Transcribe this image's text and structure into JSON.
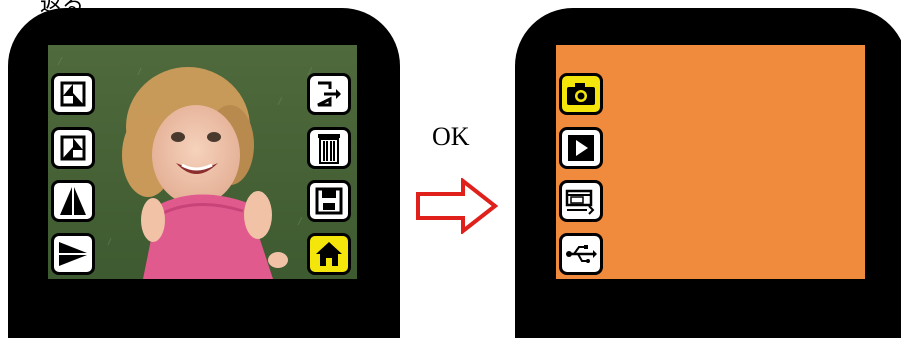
{
  "caption": "返る",
  "transition_label": "OK",
  "colors": {
    "highlight": "#F4E60A",
    "screen_blank": "#F08A3C",
    "arrow": "#E0201B",
    "bezel": "#000000"
  },
  "left_screen": {
    "left_icons": [
      "rotate-left-icon",
      "rotate-right-icon",
      "flip-horizontal-icon",
      "flip-vertical-icon"
    ],
    "right_icons": [
      "exit-icon",
      "trash-icon",
      "save-icon",
      "home-icon"
    ],
    "selected": "home-icon"
  },
  "right_screen": {
    "menu_icons": [
      "camera-icon",
      "play-icon",
      "film-scanner-icon",
      "usb-icon"
    ],
    "selected": "camera-icon"
  }
}
